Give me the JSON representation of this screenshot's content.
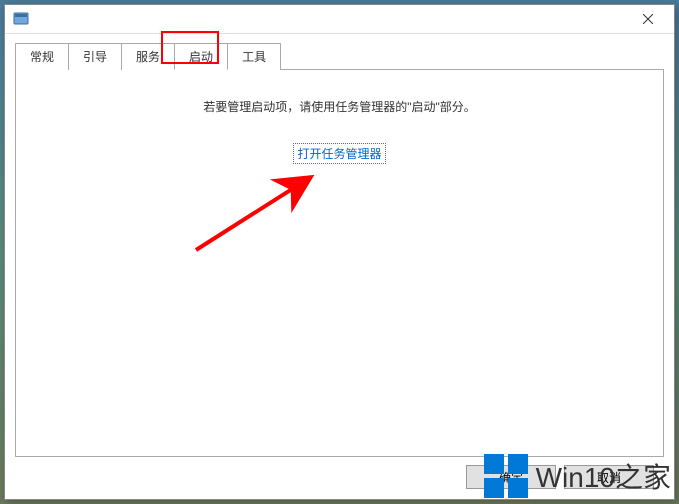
{
  "titlebar": {
    "close_icon": "close-icon"
  },
  "tabs": [
    {
      "label": "常规"
    },
    {
      "label": "引导"
    },
    {
      "label": "服务"
    },
    {
      "label": "启动",
      "active": true
    },
    {
      "label": "工具"
    }
  ],
  "panel": {
    "instruction": "若要管理启动项，请使用任务管理器的\"启动\"部分。",
    "link_label": "打开任务管理器"
  },
  "buttons": {
    "ok": "确定",
    "cancel": "取消"
  },
  "watermark": {
    "text": "Win10之家",
    "logo_color": "#0078d7"
  },
  "annotation": {
    "arrow_color": "#ff0000",
    "highlight_tab_index": 3
  }
}
